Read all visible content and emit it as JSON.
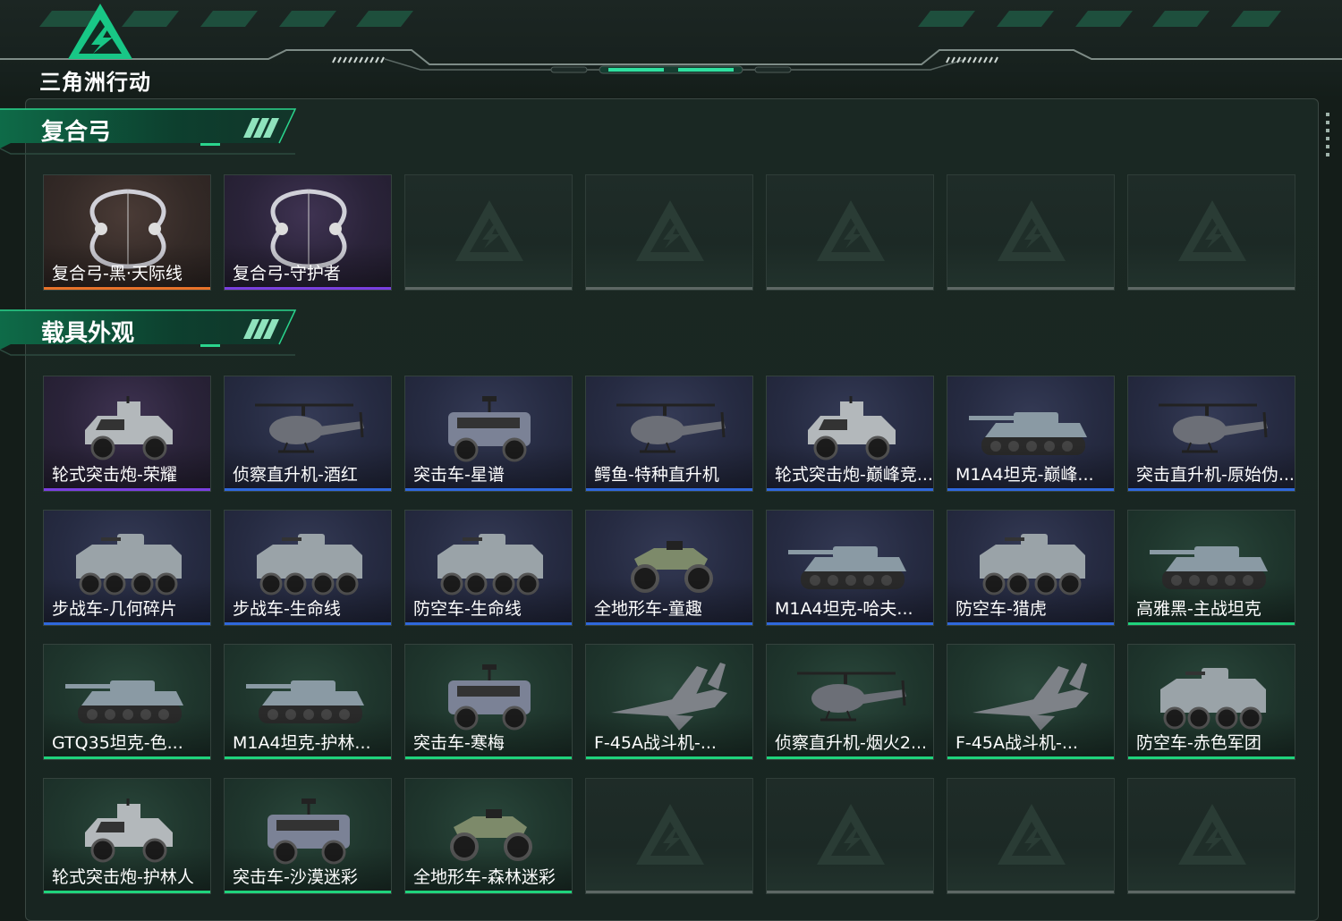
{
  "game": {
    "logo_text": "三角洲行动"
  },
  "colors": {
    "accent_green": "#1fd37c",
    "rarity_orange": "#e8722a",
    "rarity_purple": "#7a3fe0",
    "rarity_blue": "#2f68dc",
    "rarity_green": "#1fd37c"
  },
  "sections": [
    {
      "title": "复合弓",
      "items": [
        {
          "name": "复合弓-黑·天际线",
          "rarity": "orange",
          "icon": "compound-bow"
        },
        {
          "name": "复合弓-守护者",
          "rarity": "purple",
          "icon": "compound-bow"
        },
        {
          "name": "",
          "rarity": "empty"
        },
        {
          "name": "",
          "rarity": "empty"
        },
        {
          "name": "",
          "rarity": "empty"
        },
        {
          "name": "",
          "rarity": "empty"
        },
        {
          "name": "",
          "rarity": "empty"
        }
      ]
    },
    {
      "title": "载具外观",
      "items": [
        {
          "name": "轮式突击炮-荣耀",
          "rarity": "purple",
          "icon": "armored-car"
        },
        {
          "name": "侦察直升机-酒红",
          "rarity": "blue",
          "icon": "helicopter"
        },
        {
          "name": "突击车-星谱",
          "rarity": "blue",
          "icon": "assault-vehicle"
        },
        {
          "name": "鳄鱼-特种直升机",
          "rarity": "blue",
          "icon": "helicopter"
        },
        {
          "name": "轮式突击炮-巅峰竞...",
          "rarity": "blue",
          "icon": "armored-car"
        },
        {
          "name": "M1A4坦克-巅峰...",
          "rarity": "blue",
          "icon": "tank"
        },
        {
          "name": "突击直升机-原始伪...",
          "rarity": "blue",
          "icon": "helicopter"
        },
        {
          "name": "步战车-几何碎片",
          "rarity": "blue",
          "icon": "ifv"
        },
        {
          "name": "步战车-生命线",
          "rarity": "blue",
          "icon": "ifv"
        },
        {
          "name": "防空车-生命线",
          "rarity": "blue",
          "icon": "ifv"
        },
        {
          "name": "全地形车-童趣",
          "rarity": "blue",
          "icon": "atv"
        },
        {
          "name": "M1A4坦克-哈夫...",
          "rarity": "blue",
          "icon": "tank"
        },
        {
          "name": "防空车-猎虎",
          "rarity": "blue",
          "icon": "ifv"
        },
        {
          "name": "高雅黑-主战坦克",
          "rarity": "green",
          "icon": "tank"
        },
        {
          "name": "GTQ35坦克-色...",
          "rarity": "green",
          "icon": "tank"
        },
        {
          "name": "M1A4坦克-护林...",
          "rarity": "green",
          "icon": "tank"
        },
        {
          "name": "突击车-寒梅",
          "rarity": "green",
          "icon": "assault-vehicle"
        },
        {
          "name": "F-45A战斗机-...",
          "rarity": "green",
          "icon": "fighter-jet"
        },
        {
          "name": "侦察直升机-烟火2...",
          "rarity": "green",
          "icon": "helicopter"
        },
        {
          "name": "F-45A战斗机-...",
          "rarity": "green",
          "icon": "fighter-jet"
        },
        {
          "name": "防空车-赤色军团",
          "rarity": "green",
          "icon": "ifv"
        },
        {
          "name": "轮式突击炮-护林人",
          "rarity": "green",
          "icon": "armored-car"
        },
        {
          "name": "突击车-沙漠迷彩",
          "rarity": "green",
          "icon": "assault-vehicle"
        },
        {
          "name": "全地形车-森林迷彩",
          "rarity": "green",
          "icon": "atv"
        },
        {
          "name": "",
          "rarity": "empty"
        },
        {
          "name": "",
          "rarity": "empty"
        },
        {
          "name": "",
          "rarity": "empty"
        },
        {
          "name": "",
          "rarity": "empty"
        }
      ]
    }
  ]
}
